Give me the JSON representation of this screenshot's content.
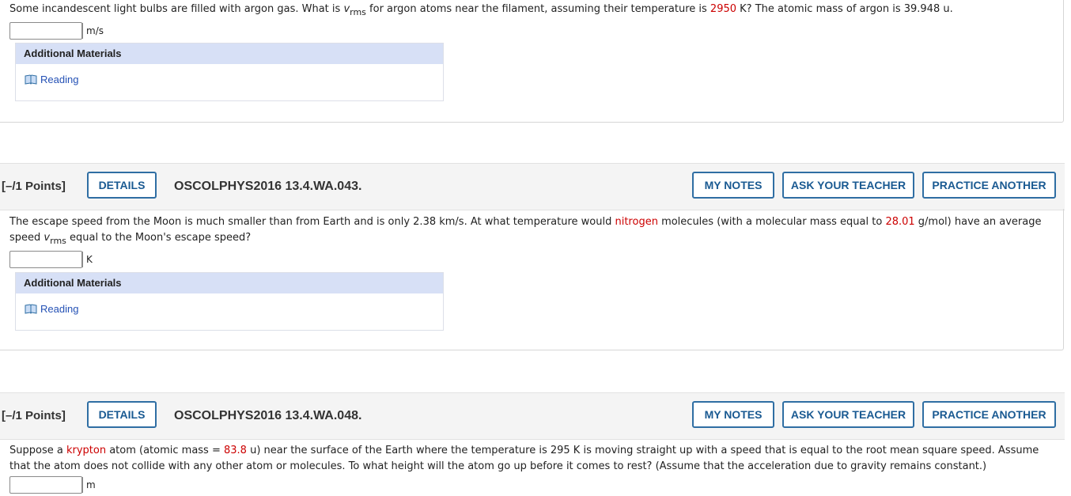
{
  "q1": {
    "text_a": "Some incandescent light bulbs are filled with argon gas. What is ",
    "v": "v",
    "rms": "rms",
    "text_b": " for argon atoms near the filament, assuming their temperature is ",
    "temp": "2950",
    "text_c": " K? The atomic mass of argon is 39.948 u.",
    "unit": "m/s",
    "materials_title": "Additional Materials",
    "reading_label": "Reading"
  },
  "q2": {
    "points": "[–/1 Points]",
    "details_label": "DETAILS",
    "question_id": "OSCOLPHYS2016 13.4.WA.043.",
    "my_notes_label": "MY NOTES",
    "ask_teacher_label": "ASK YOUR TEACHER",
    "practice_label": "PRACTICE ANOTHER",
    "text_a": "The escape speed from the Moon is much smaller than from Earth and is only 2.38 km/s. At what temperature would ",
    "molecule": "nitrogen",
    "text_b": " molecules (with a molecular mass equal to ",
    "mass": "28.01",
    "text_c": " g/mol) have an average",
    "text_d": "speed ",
    "v": "v",
    "rms": "rms",
    "text_e": " equal to the Moon's escape speed?",
    "unit": "K",
    "materials_title": "Additional Materials",
    "reading_label": "Reading"
  },
  "q3": {
    "points": "[–/1 Points]",
    "details_label": "DETAILS",
    "question_id": "OSCOLPHYS2016 13.4.WA.048.",
    "my_notes_label": "MY NOTES",
    "ask_teacher_label": "ASK YOUR TEACHER",
    "practice_label": "PRACTICE ANOTHER",
    "text_a": "Suppose a ",
    "atom": "krypton",
    "text_b": " atom (atomic mass = ",
    "mass": "83.8",
    "text_c": " u) near the surface of the Earth where the temperature is 295 K is moving straight up with a speed that is equal to the root mean square speed. Assume",
    "text_d": "that the atom does not collide with any other atom or molecules. To what height will the atom go up before it comes to rest? (Assume that the acceleration due to gravity remains constant.)",
    "unit": "m"
  },
  "colors": {
    "accent": "#2f6ea3",
    "highlight_red": "#cc0000",
    "materials_header_bg": "#d7e0f6",
    "link_blue": "#2451b5"
  },
  "icons": {
    "reading": "book-icon"
  }
}
